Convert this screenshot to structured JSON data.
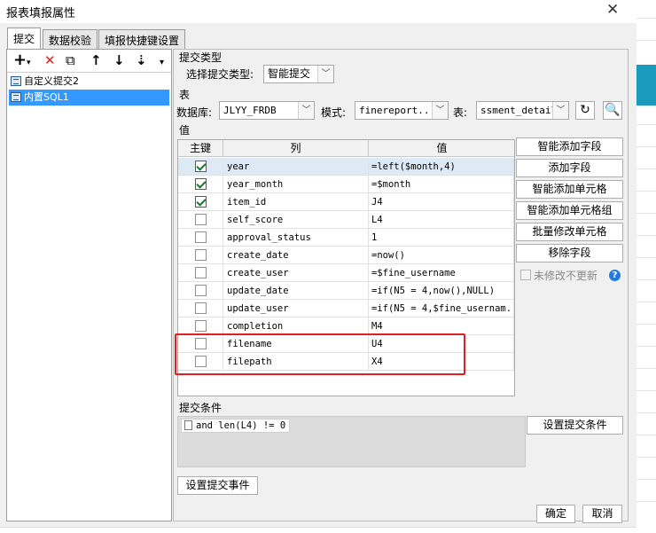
{
  "window": {
    "title": "报表填报属性",
    "close": "✕"
  },
  "tabs": [
    "提交",
    "数据校验",
    "填报快捷键设置"
  ],
  "toolbar": {
    "add": "+",
    "add_caret": "▾",
    "delete": "✕",
    "copy": "⧉",
    "up": "↑",
    "down": "↓",
    "sort": "⇣"
  },
  "tree": [
    {
      "label": "自定义提交2"
    },
    {
      "label": "内置SQL1"
    }
  ],
  "submit_type": {
    "section": "提交类型",
    "label": "选择提交类型:",
    "value": "智能提交"
  },
  "table_section": {
    "section": "表",
    "db_label": "数据库:",
    "db_value": "JLYY_FRDB",
    "schema_label": "模式:",
    "schema_value": "finereport...",
    "table_label": "表:",
    "table_value": "ssment_detail",
    "refresh_icon": "refresh-icon",
    "preview_icon": "preview-icon"
  },
  "values_section": {
    "section": "值",
    "headers": {
      "key": "主键",
      "column": "列",
      "value": "值"
    },
    "rows": [
      {
        "key": true,
        "column": "year",
        "value": "=left($month,4)"
      },
      {
        "key": true,
        "column": "year_month",
        "value": "=$month"
      },
      {
        "key": true,
        "column": "item_id",
        "value": "J4"
      },
      {
        "key": false,
        "column": "self_score",
        "value": "L4"
      },
      {
        "key": false,
        "column": "approval_status",
        "value": "1"
      },
      {
        "key": false,
        "column": "create_date",
        "value": "=now()"
      },
      {
        "key": false,
        "column": "create_user",
        "value": "=$fine_username"
      },
      {
        "key": false,
        "column": "update_date",
        "value": "=if(N5 = 4,now(),NULL)"
      },
      {
        "key": false,
        "column": "update_user",
        "value": "=if(N5 = 4,$fine_usernam..."
      },
      {
        "key": false,
        "column": "completion",
        "value": "M4"
      },
      {
        "key": false,
        "column": "filename",
        "value": "U4"
      },
      {
        "key": false,
        "column": "filepath",
        "value": "X4"
      }
    ]
  },
  "side_buttons": [
    "智能添加字段",
    "添加字段",
    "智能添加单元格",
    "智能添加单元格组",
    "批量修改单元格",
    "移除字段"
  ],
  "no_update_unchanged": "未修改不更新",
  "help": "?",
  "condition": {
    "section": "提交条件",
    "text": "and len(L4) != 0",
    "button": "设置提交条件"
  },
  "event_button": "设置提交事件",
  "footer": {
    "ok": "确定",
    "cancel": "取消"
  },
  "colors": {
    "selection": "#3399ff",
    "highlight_box": "#e02020",
    "check": "#0a7d2c"
  }
}
